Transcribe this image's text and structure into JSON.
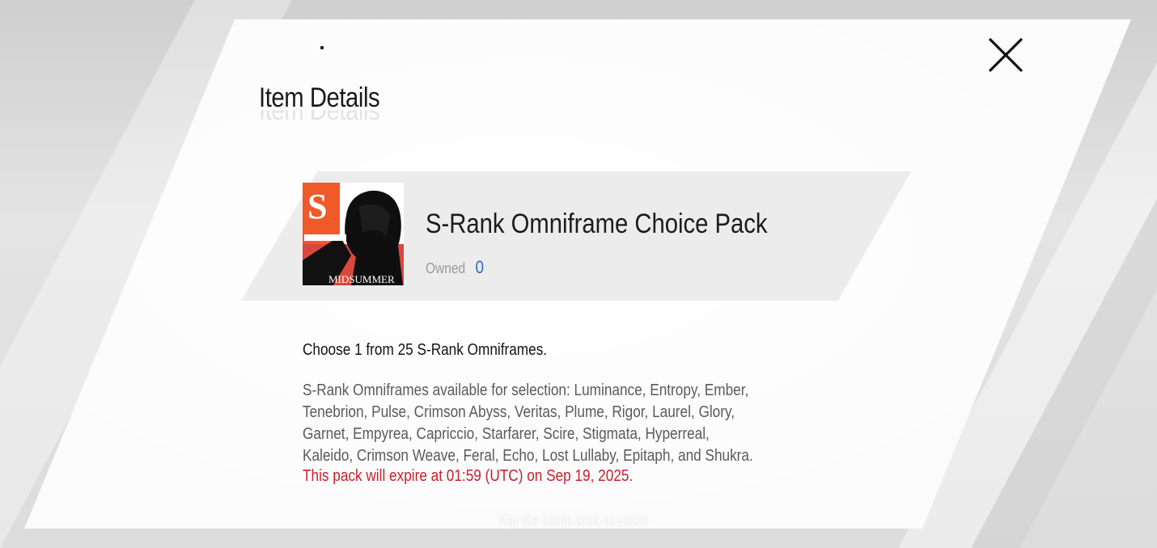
{
  "dialog": {
    "title": "Item Details"
  },
  "item": {
    "name": "S-Rank Omniframe Choice Pack",
    "owned_label": "Owned",
    "owned_value": "0",
    "icon_text_top": "S",
    "icon_text_bottom": "MIDSUMMER",
    "icon_accent_color": "#f05a28"
  },
  "description": {
    "main": "Choose 1 from 25 S-Rank Omniframes.",
    "list_lines": [
      "S-Rank Omniframes available for selection: Luminance, Entropy, Ember,",
      " Tenebrion, Pulse, Crimson Abyss, Veritas, Plume, Rigor, Laurel, Glory,",
      "Garnet, Empyrea, Capriccio, Starfarer, Scire, Stigmata, Hyperreal,",
      "Kaleido, Crimson Weave, Feral, Echo, Lost Lullaby, Epitaph, and Shukra."
    ],
    "expire": "This pack will expire at 01:59 (UTC) on Sep 19, 2025.",
    "expire_color": "#c8202f"
  },
  "footer": {
    "hint": "Tap the blank area to close"
  },
  "icons": {
    "close": "close-icon"
  }
}
